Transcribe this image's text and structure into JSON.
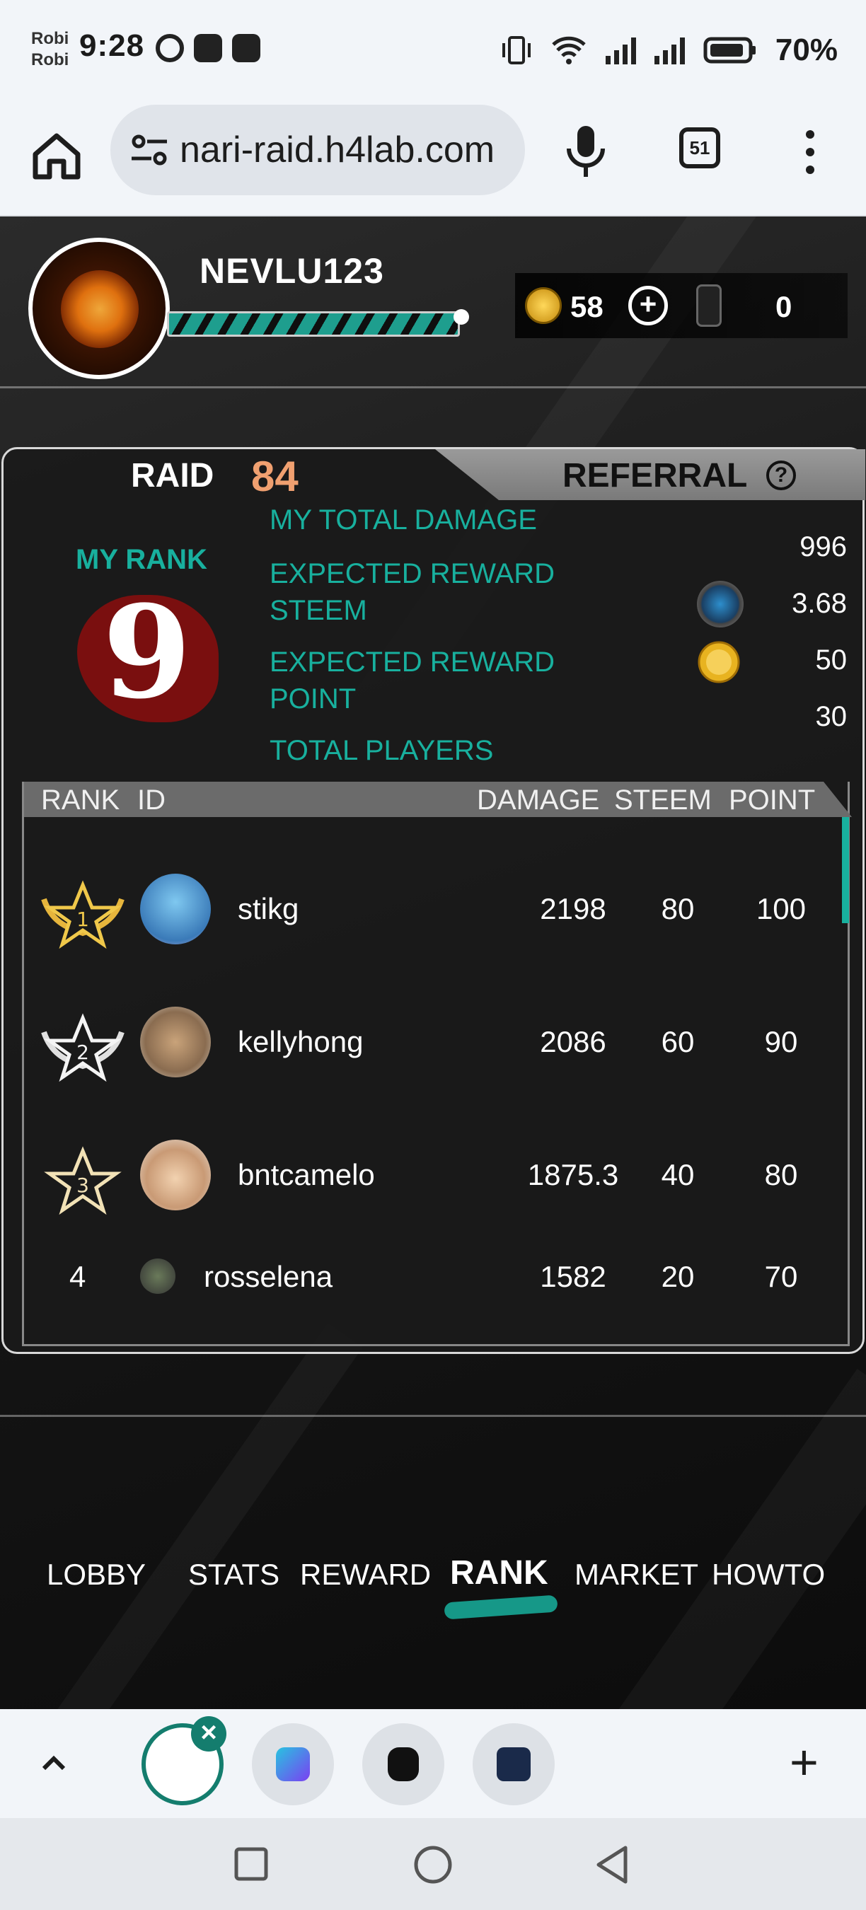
{
  "status_bar": {
    "carrier_top": "Robi",
    "carrier_bottom": "Robi",
    "time": "9:28",
    "battery": "70%"
  },
  "browser": {
    "url": "nari-raid.h4lab.com",
    "tab_count": "51"
  },
  "player": {
    "username": "NEVLU123",
    "xp_fraction": 0.92,
    "coins": "58",
    "tickets": "0"
  },
  "panel": {
    "tab_raid": "RAID",
    "raid_number": "84",
    "tab_referral": "REFERRAL",
    "help": "?",
    "my_rank_label": "MY RANK",
    "my_rank": "9",
    "stats": [
      {
        "label": "MY TOTAL DAMAGE",
        "value": "996"
      },
      {
        "label": "EXPECTED REWARD\nSTEEM",
        "value": "3.68"
      },
      {
        "label": "EXPECTED REWARD\nPOINT",
        "value": "50"
      },
      {
        "label": "TOTAL PLAYERS",
        "value": "30"
      }
    ]
  },
  "table": {
    "headers": {
      "rank": "RANK",
      "id": "ID",
      "damage": "DAMAGE",
      "steem": "STEEM",
      "point": "POINT"
    },
    "rows": [
      {
        "rank": "1",
        "id": "stikg",
        "damage": "2198",
        "steem": "80",
        "point": "100"
      },
      {
        "rank": "2",
        "id": "kellyhong",
        "damage": "2086",
        "steem": "60",
        "point": "90"
      },
      {
        "rank": "3",
        "id": "bntcamelo",
        "damage": "1875.3",
        "steem": "40",
        "point": "80"
      },
      {
        "rank": "4",
        "id": "rosselena",
        "damage": "1582",
        "steem": "20",
        "point": "70"
      }
    ]
  },
  "nav": {
    "lobby": "LOBBY",
    "stats": "STATS",
    "reward": "REWARD",
    "rank": "RANK",
    "market": "MARKET",
    "howto": "HOWTO"
  },
  "tabstrip": {
    "close": "×",
    "new_tab": "+"
  },
  "colors": {
    "accent": "#18b09e",
    "raid_number": "#f0a070",
    "rank_splat": "#7a0f0f"
  }
}
